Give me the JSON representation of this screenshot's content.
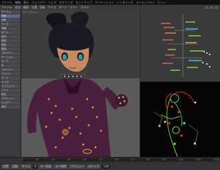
{
  "menu": [
    "ファイル",
    "編集",
    "表示",
    "ウィンドウ",
    "ヘルプ",
    "モデリング",
    "セットアップ",
    "アニメーション",
    "レンダリング",
    "ユーティリティ",
    "ビュー"
  ],
  "toolbar": [
    "アイテム",
    "追加",
    "複製",
    "位置",
    "回転",
    "サイズ",
    "ボーン",
    "ライト",
    "カメラ"
  ],
  "sidebar": [
    "アイテム",
    "移動",
    "回転",
    "サイズ",
    "伸縮",
    "ボーン",
    "追加",
    "削除",
    "複製",
    "置換",
    "プロパティ",
    "モーション",
    "カーブ",
    "IK",
    "ジョイント",
    "ウェイト",
    "ライト",
    "カメラ",
    "オブジェクト",
    "シーン",
    "設定",
    "プレビュー",
    "レンダー",
    "保存"
  ],
  "viewport": {
    "label": "カメラビュー"
  },
  "timeline": {
    "ticks": [
      "0",
      "10",
      "20",
      "30",
      "40",
      "50",
      "60",
      "70",
      "80",
      "90",
      "100",
      "110",
      "120"
    ],
    "labels": [
      "位置",
      "回転",
      "サイズ",
      "キー作成",
      "キー削除",
      "プレビュー",
      "ステップ"
    ],
    "frame": "0",
    "end": "120"
  },
  "colors": {
    "bg": "#2b2b2d",
    "suit": "#4a1f3d",
    "glow": "#e8a040",
    "lime": "#88ff44",
    "red": "#ff3030"
  }
}
